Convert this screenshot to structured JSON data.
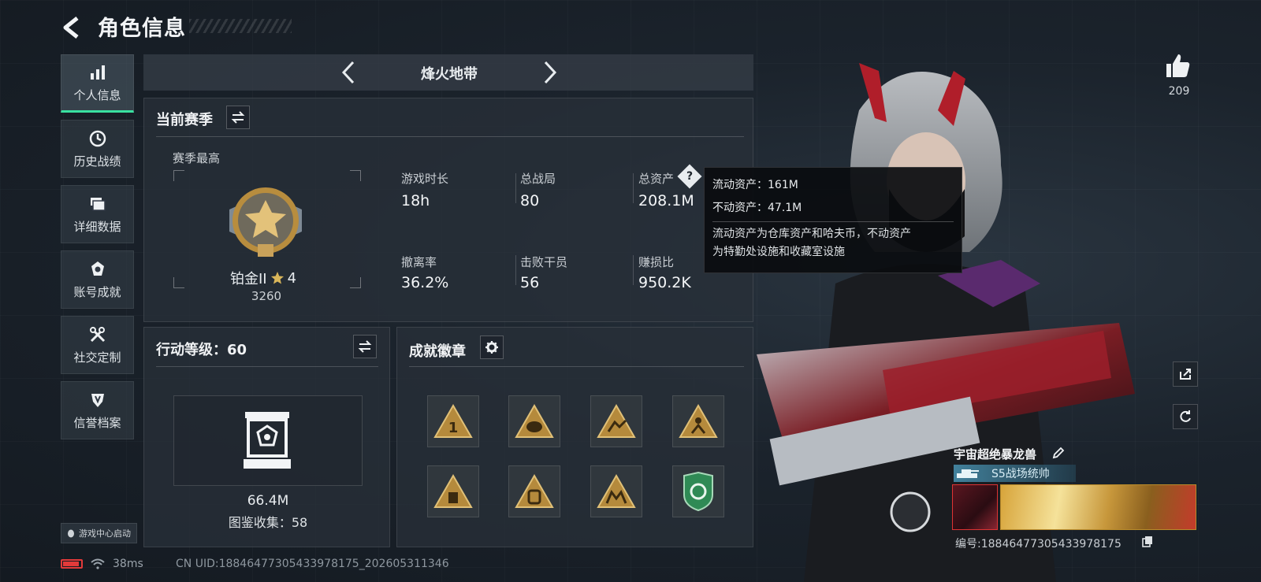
{
  "header": {
    "title": "角色信息"
  },
  "sidebar": {
    "items": [
      {
        "label": "个人信息",
        "icon": "bar-chart-icon",
        "active": true
      },
      {
        "label": "历史战绩",
        "icon": "clock-icon"
      },
      {
        "label": "详细数据",
        "icon": "folder-icon"
      },
      {
        "label": "账号成就",
        "icon": "achievement-icon"
      },
      {
        "label": "社交定制",
        "icon": "tools-icon"
      },
      {
        "label": "信誉档案",
        "icon": "shield-badge-icon"
      }
    ],
    "launch_label": "游戏中心启动"
  },
  "status": {
    "ping": "38ms",
    "uid": "CN UID:18846477305433978175_202605311346",
    "battery_color": "#e23a3a"
  },
  "mode": {
    "name": "烽火地带"
  },
  "season": {
    "title": "当前赛季",
    "best_label": "赛季最高",
    "rank": {
      "name": "铂金II",
      "stars": "4",
      "score": "3260"
    },
    "stats": [
      {
        "label": "游戏时长",
        "value": "18h"
      },
      {
        "label": "总战局",
        "value": "80"
      },
      {
        "label": "总资产",
        "value": "208.1M",
        "has_help": true
      },
      {
        "label": "撤离率",
        "value": "36.2%"
      },
      {
        "label": "击败干员",
        "value": "56"
      },
      {
        "label": "赚损比",
        "value": "950.2K"
      }
    ]
  },
  "tooltip": {
    "liquid": "流动资产：161M",
    "fixed": "不动资产：47.1M",
    "desc_line1": "流动资产为仓库资产和哈夫币，不动资产",
    "desc_line2": "为特勤处设施和收藏室设施"
  },
  "level": {
    "title": "行动等级：60",
    "value": "66.4M",
    "collection": "图鉴收集：58"
  },
  "badges": {
    "title": "成就徽章",
    "count": 8
  },
  "profile": {
    "likes": "209",
    "nickname": "宇宙超绝暴龙兽",
    "rank_title": "S5战场统帅",
    "player_no": "编号:18846477305433978175"
  },
  "colors": {
    "accent": "#39e0a0",
    "gold": "#c9a25a",
    "badge_green": "#2f8a55"
  }
}
